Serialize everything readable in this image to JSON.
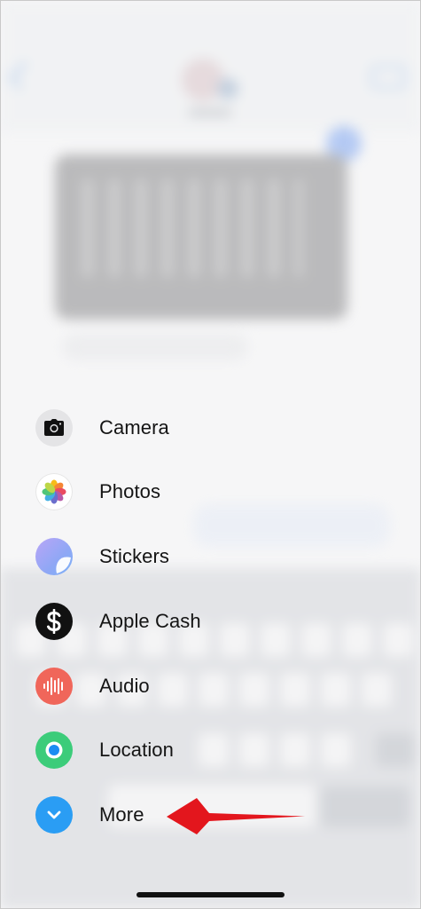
{
  "menu": {
    "items": [
      {
        "label": "Camera",
        "icon": "camera-icon"
      },
      {
        "label": "Photos",
        "icon": "photos-icon"
      },
      {
        "label": "Stickers",
        "icon": "stickers-icon"
      },
      {
        "label": "Apple Cash",
        "icon": "dollar-icon"
      },
      {
        "label": "Audio",
        "icon": "waveform-icon"
      },
      {
        "label": "Location",
        "icon": "location-icon"
      },
      {
        "label": "More",
        "icon": "chevron-down-icon"
      }
    ]
  },
  "colors": {
    "camera_bg": "#e4e4e6",
    "cash_bg": "#111111",
    "audio_bg": "#f0665a",
    "location_bg": "#3ccc7a",
    "more_bg": "#2a9df4",
    "annotation_arrow": "#e3161d"
  }
}
